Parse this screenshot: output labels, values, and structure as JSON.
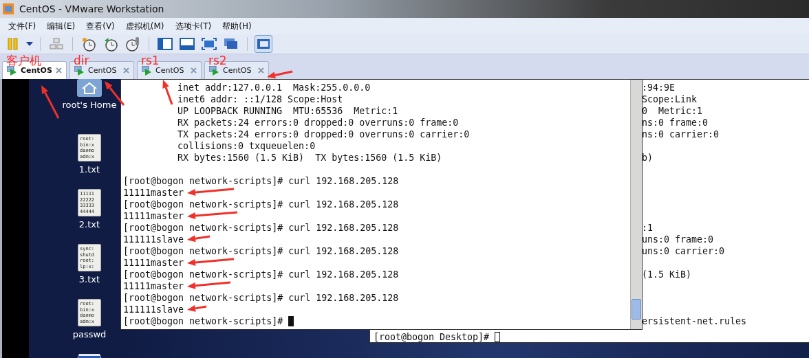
{
  "window": {
    "title": "CentOS - VMware Workstation"
  },
  "menu": [
    "文件(F)",
    "编辑(E)",
    "查看(V)",
    "虚拟机(M)",
    "选项卡(T)",
    "帮助(H)"
  ],
  "tabs": [
    {
      "label": "CentOS",
      "selected": true,
      "note": "客户机"
    },
    {
      "label": "CentOS",
      "selected": false,
      "note": "dir"
    },
    {
      "label": "CentOS",
      "selected": false,
      "note": "rs1"
    },
    {
      "label": "CentOS",
      "selected": false,
      "note": "rs2"
    }
  ],
  "desktop": {
    "icons": [
      {
        "kind": "home",
        "label": "root's Home"
      },
      {
        "kind": "text",
        "label": "1.txt",
        "preview": [
          "root:",
          "bin:x",
          "daemo",
          "adm:x"
        ]
      },
      {
        "kind": "text",
        "label": "2.txt",
        "preview": [
          "11111",
          "22222",
          "33333",
          "44444"
        ]
      },
      {
        "kind": "text",
        "label": "3.txt",
        "preview": [
          "sync:",
          "shutd",
          "root:",
          "lp:x:"
        ]
      },
      {
        "kind": "text",
        "label": "passwd",
        "preview": [
          "root:",
          "bin:x",
          "daemo",
          "adm:x"
        ]
      },
      {
        "kind": "drive"
      }
    ]
  },
  "front_terminal": {
    "lines": [
      {
        "kind": "indent",
        "text": "inet addr:127.0.0.1  Mask:255.0.0.0"
      },
      {
        "kind": "indent",
        "text": "inet6 addr: ::1/128 Scope:Host"
      },
      {
        "kind": "indent",
        "text": "UP LOOPBACK RUNNING  MTU:65536  Metric:1"
      },
      {
        "kind": "indent",
        "text": "RX packets:24 errors:0 dropped:0 overruns:0 frame:0"
      },
      {
        "kind": "indent",
        "text": "TX packets:24 errors:0 dropped:0 overruns:0 carrier:0"
      },
      {
        "kind": "indent",
        "text": "collisions:0 txqueuelen:0"
      },
      {
        "kind": "indent",
        "text": "RX bytes:1560 (1.5 KiB)  TX bytes:1560 (1.5 KiB)"
      },
      {
        "kind": "blank"
      },
      {
        "kind": "plain",
        "text": "[root@bogon network-scripts]# curl 192.168.205.128"
      },
      {
        "kind": "plain",
        "text": "11111master"
      },
      {
        "kind": "plain",
        "text": "[root@bogon network-scripts]# curl 192.168.205.128"
      },
      {
        "kind": "plain",
        "text": "11111master"
      },
      {
        "kind": "plain",
        "text": "[root@bogon network-scripts]# curl 192.168.205.128"
      },
      {
        "kind": "plain",
        "text": "111111slave"
      },
      {
        "kind": "plain",
        "text": "[root@bogon network-scripts]# curl 192.168.205.128"
      },
      {
        "kind": "plain",
        "text": "11111master"
      },
      {
        "kind": "plain",
        "text": "[root@bogon network-scripts]# curl 192.168.205.128"
      },
      {
        "kind": "plain",
        "text": "11111master"
      },
      {
        "kind": "plain",
        "text": "[root@bogon network-scripts]# curl 192.168.205.128"
      },
      {
        "kind": "plain",
        "text": "111111slave"
      },
      {
        "kind": "cursor",
        "text": "[root@bogon network-scripts]#"
      }
    ]
  },
  "back_terminal": {
    "lines": [
      {
        "kind": "plain",
        "text": ":94:9E"
      },
      {
        "kind": "plain",
        "text": "Scope:Link"
      },
      {
        "kind": "plain",
        "text": "0  Metric:1"
      },
      {
        "kind": "plain",
        "text": "ns:0 frame:0"
      },
      {
        "kind": "plain",
        "text": "ns:0 carrier:0"
      },
      {
        "kind": "blank"
      },
      {
        "kind": "plain",
        "text": "b)"
      },
      {
        "kind": "blank"
      },
      {
        "kind": "blank"
      },
      {
        "kind": "blank"
      },
      {
        "kind": "blank"
      },
      {
        "kind": "blank"
      },
      {
        "kind": "plain",
        "text": ":1"
      },
      {
        "kind": "plain",
        "text": "uns:0 frame:0"
      },
      {
        "kind": "plain",
        "text": "uns:0 carrier:0"
      },
      {
        "kind": "blank"
      },
      {
        "kind": "plain",
        "text": "(1.5 KiB)"
      },
      {
        "kind": "blank"
      },
      {
        "kind": "blank"
      },
      {
        "kind": "blank"
      },
      {
        "kind": "plain",
        "text": "ersistent-net.rules"
      }
    ],
    "prompt": "[root@bogon Desktop]#"
  }
}
